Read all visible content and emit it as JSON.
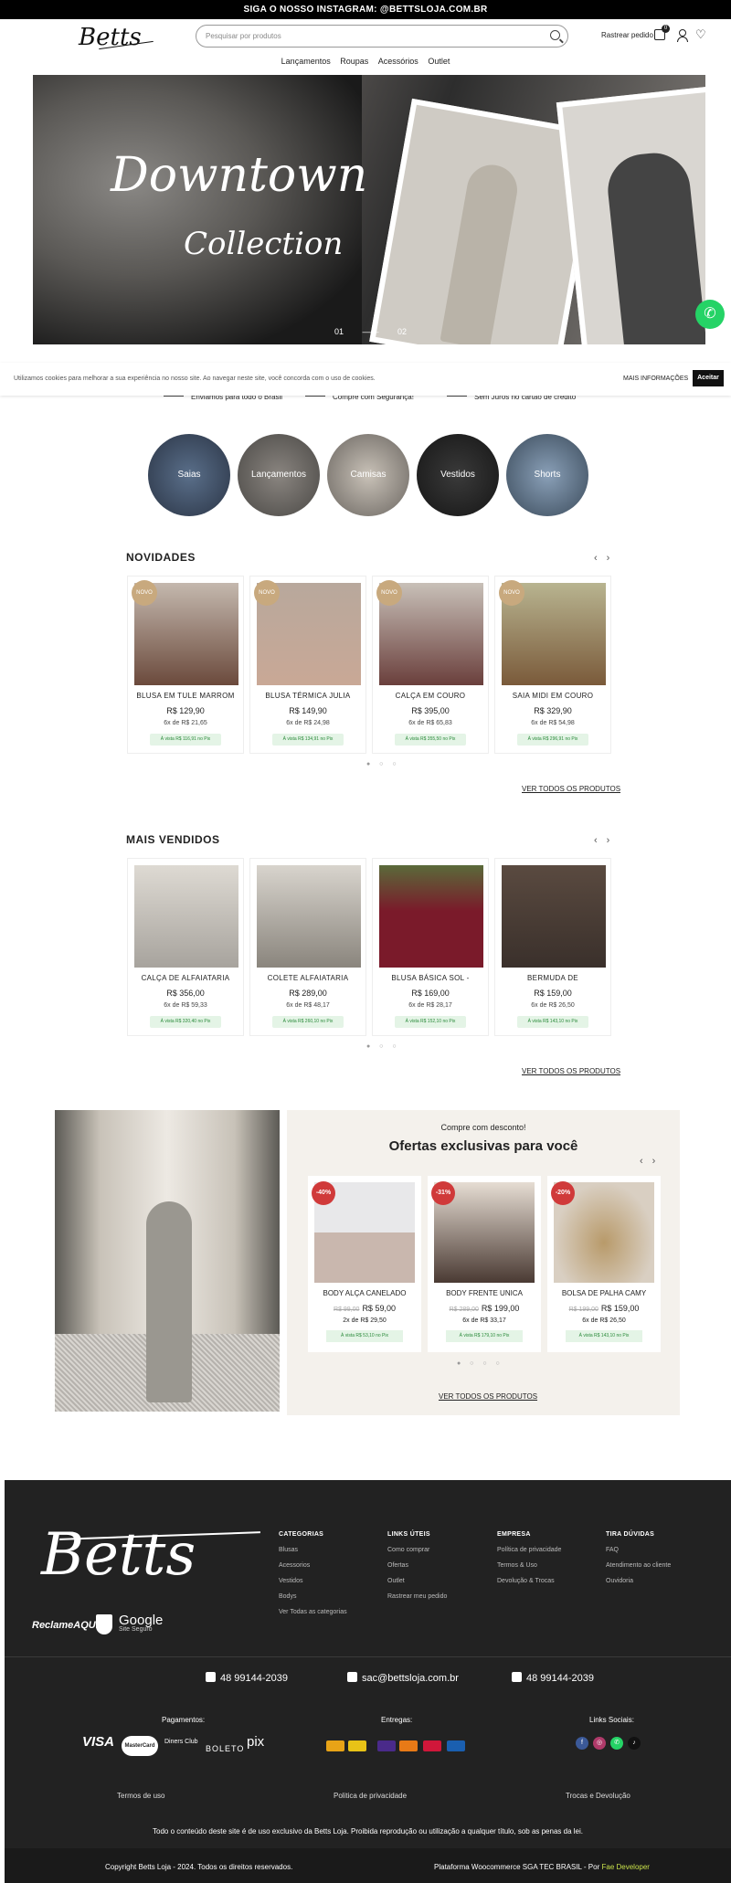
{
  "topbar": {
    "text": "SIGA O NOSSO INSTAGRAM: @BETTSLOJA.COM.BR"
  },
  "header": {
    "logo": "Betts",
    "search_placeholder": "Pesquisar por produtos",
    "track_order": "Rastrear pedido",
    "cart_count": "0"
  },
  "nav": [
    "Lançamentos",
    "Roupas",
    "Acessórios",
    "Outlet"
  ],
  "hero": {
    "title_line1": "Downtown",
    "title_line2": "Collection",
    "slides": [
      "01",
      "02"
    ]
  },
  "cookie": {
    "message": "Utilizamos cookies para melhorar a sua experiência no nosso site. Ao navegar neste site, você concorda com o uso de cookies.",
    "more": "MAIS INFORMAÇÕES",
    "accept": "Aceitar"
  },
  "perks": [
    "Enviamos para todo o Brasil",
    "Compre com Segurança!",
    "Sem Juros no cartão de crédito"
  ],
  "categories": [
    "Saias",
    "Lançamentos",
    "Camisas",
    "Vestidos",
    "Shorts"
  ],
  "novidades": {
    "title": "NOVIDADES",
    "badge": "NOVO",
    "products": [
      {
        "name": "BLUSA EM TULE MARROM",
        "price": "R$ 129,90",
        "installments": "6x de R$ 21,65",
        "pix": "À vista R$ 116,91 no Pix",
        "color": "#6b4a3c"
      },
      {
        "name": "BLUSA TÉRMICA JULIA",
        "price": "R$ 149,90",
        "installments": "6x de R$ 24,98",
        "pix": "À vista R$ 134,91 no Pix",
        "color": "#c9a896"
      },
      {
        "name": "CALÇA EM COURO",
        "price": "R$ 395,00",
        "installments": "6x de R$ 65,83",
        "pix": "À vista R$ 355,50 no Pix",
        "color": "#6a3f3c"
      },
      {
        "name": "SAIA MIDI EM COURO",
        "price": "R$ 329,90",
        "installments": "6x de R$ 54,98",
        "pix": "À vista R$ 296,91 no Pix",
        "color": "#7a5a3a"
      }
    ],
    "view_all": "VER TODOS OS PRODUTOS"
  },
  "mais_vendidos": {
    "title": "MAIS VENDIDOS",
    "products": [
      {
        "name": "CALÇA DE ALFAIATARIA",
        "price": "R$ 356,00",
        "installments": "6x de R$ 59,33",
        "pix": "À vista R$ 320,40 no Pix",
        "color": "#a7a39d"
      },
      {
        "name": "COLETE ALFAIATARIA",
        "price": "R$ 289,00",
        "installments": "6x de R$ 48,17",
        "pix": "À vista R$ 260,10 no Pix",
        "color": "#b0aba3"
      },
      {
        "name": "BLUSA BÁSICA SOL -",
        "price": "R$ 169,00",
        "installments": "6x de R$ 28,17",
        "pix": "À vista R$ 152,10 no Pix",
        "color": "#7a1a2a"
      },
      {
        "name": "BERMUDA DE",
        "price": "R$ 159,00",
        "installments": "6x de R$ 26,50",
        "pix": "À vista R$ 143,10 no Pix",
        "color": "#3a302b"
      }
    ],
    "view_all": "VER TODOS OS PRODUTOS"
  },
  "offers": {
    "subtitle": "Compre com desconto!",
    "title": "Ofertas exclusivas para você",
    "products": [
      {
        "discount": "-40%",
        "name": "BODY ALÇA CANELADO",
        "old_price": "R$ 99,00",
        "price": "R$ 59,00",
        "installments": "2x de R$ 29,50",
        "pix": "À vista R$ 53,10 no Pix",
        "color": "#c9b7ae"
      },
      {
        "discount": "-31%",
        "name": "BODY FRENTE UNICA",
        "old_price": "R$ 289,00",
        "price": "R$ 199,00",
        "installments": "6x de R$ 33,17",
        "pix": "À vista R$ 179,10 no Pix",
        "color": "#4a3a33"
      },
      {
        "discount": "-20%",
        "name": "BOLSA DE PALHA CAMY",
        "old_price": "R$ 199,00",
        "price": "R$ 159,00",
        "installments": "6x de R$ 26,50",
        "pix": "À vista R$ 143,10 no Pix",
        "color": "#b89a6a"
      }
    ],
    "view_all": "VER TODOS OS PRODUTOS"
  },
  "footer": {
    "logo": "Betts",
    "reclame": "ReclameAQUI",
    "google": "Google",
    "google_sub": "Site Seguro",
    "columns": [
      {
        "title": "CATEGORIAS",
        "links": [
          "Blusas",
          "Acessorios",
          "Vestidos",
          "Bodys",
          "Ver Todas as categorias"
        ]
      },
      {
        "title": "LINKS ÚTEIS",
        "links": [
          "Como comprar",
          "Ofertas",
          "Outlet",
          "Rastrear meu pedido"
        ]
      },
      {
        "title": "EMPRESA",
        "links": [
          "Política de privacidade",
          "Termos & Uso",
          "Devolução & Trocas"
        ]
      },
      {
        "title": "TIRA DÚVIDAS",
        "links": [
          "FAQ",
          "Atendimento ao cliente",
          "Ouvidoria"
        ]
      }
    ],
    "contacts": [
      "48 99144-2039",
      "sac@bettsloja.com.br",
      "48 99144-2039"
    ],
    "payments_label": "Pagamentos:",
    "payment_brands": [
      "VISA",
      "MasterCard",
      "Diners Club",
      "BOLETO",
      "pix"
    ],
    "shipping_label": "Entregas:",
    "social_label": "Links Sociais:",
    "links": [
      "Termos de uso",
      "Politica de privacidade",
      "Trocas e Devolução"
    ],
    "notice": "Todo o conteúdo deste site é de uso exclusivo da Betts Loja. Proibida reprodução ou utilização a qualquer título, sob as penas da lei.",
    "copyright": "Copyright Betts Loja - 2024. Todos os direitos reservados.",
    "platform": "Plataforma Woocommerce SGA TEC BRASIL - Por",
    "developer": "Fae Developer"
  }
}
